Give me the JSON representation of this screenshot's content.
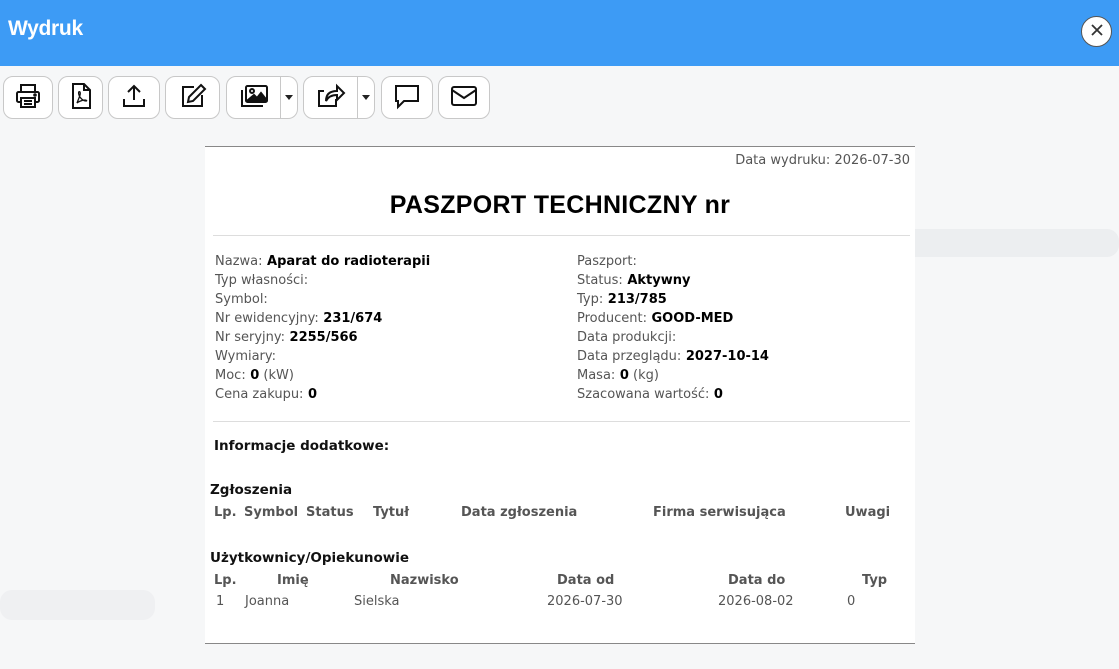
{
  "window": {
    "title": "Wydruk"
  },
  "toolbar": {
    "buttons": [
      {
        "icon": "printer-icon"
      },
      {
        "icon": "pdf-icon"
      },
      {
        "icon": "upload-icon"
      },
      {
        "icon": "edit-icon"
      },
      {
        "icon": "images-icon"
      },
      {
        "icon": "share-icon"
      },
      {
        "icon": "comment-icon"
      },
      {
        "icon": "envelope-icon"
      }
    ]
  },
  "document": {
    "print_date_label": "Data wydruku:",
    "print_date": "2026-07-30",
    "title": "PASZPORT TECHNICZNY nr",
    "left_fields": [
      {
        "label": "Nazwa:",
        "value": "Aparat do radioterapii",
        "unit": ""
      },
      {
        "label": "Typ własności:",
        "value": "",
        "unit": ""
      },
      {
        "label": "Symbol:",
        "value": "",
        "unit": ""
      },
      {
        "label": "Nr ewidencyjny:",
        "value": "231/674",
        "unit": ""
      },
      {
        "label": "Nr seryjny:",
        "value": "2255/566",
        "unit": ""
      },
      {
        "label": "Wymiary:",
        "value": "",
        "unit": ""
      },
      {
        "label": "Moc:",
        "value": "0",
        "unit": "(kW)"
      },
      {
        "label": "Cena zakupu:",
        "value": "0",
        "unit": ""
      }
    ],
    "right_fields": [
      {
        "label": "Paszport:",
        "value": "",
        "unit": ""
      },
      {
        "label": "Status:",
        "value": "Aktywny",
        "unit": ""
      },
      {
        "label": "Typ:",
        "value": "213/785",
        "unit": ""
      },
      {
        "label": "Producent:",
        "value": "GOOD-MED",
        "unit": ""
      },
      {
        "label": "Data produkcji:",
        "value": "",
        "unit": ""
      },
      {
        "label": "Data przeglądu:",
        "value": "2027-10-14",
        "unit": ""
      },
      {
        "label": "Masa:",
        "value": "0",
        "unit": "(kg)"
      },
      {
        "label": "Szacowana wartość:",
        "value": "0",
        "unit": ""
      }
    ],
    "additional_info_heading": "Informacje dodatkowe:",
    "reports": {
      "heading": "Zgłoszenia",
      "columns": [
        "Lp.",
        "Symbol",
        "Status",
        "Tytuł",
        "Data zgłoszenia",
        "Firma serwisująca",
        "Uwagi"
      ]
    },
    "users": {
      "heading": "Użytkownicy/Opiekunowie",
      "columns": [
        "Lp.",
        "Imię",
        "Nazwisko",
        "Data od",
        "Data do",
        "Typ"
      ],
      "rows": [
        [
          "1",
          "Joanna",
          "Sielska",
          "2026-07-30",
          "2026-08-02",
          "0"
        ]
      ]
    }
  }
}
